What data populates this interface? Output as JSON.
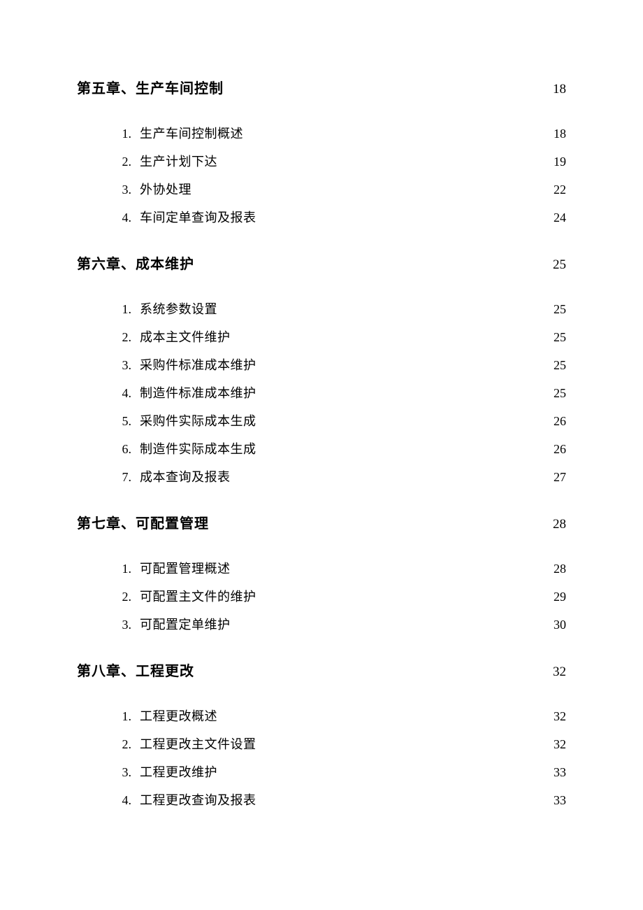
{
  "chapters": [
    {
      "title": "第五章、生产车间控制",
      "page": "18",
      "sections": [
        {
          "num": "1.",
          "title": "生产车间控制概述",
          "page": "18"
        },
        {
          "num": "2.",
          "title": "生产计划下达",
          "page": "19"
        },
        {
          "num": "3.",
          "title": "外协处理",
          "page": "22"
        },
        {
          "num": "4.",
          "title": "车间定单查询及报表",
          "page": "24"
        }
      ]
    },
    {
      "title": "第六章、成本维护",
      "page": "25",
      "sections": [
        {
          "num": "1.",
          "title": "系统参数设置",
          "page": "25"
        },
        {
          "num": "2.",
          "title": "成本主文件维护",
          "page": "25"
        },
        {
          "num": "3.",
          "title": "采购件标准成本维护",
          "page": "25"
        },
        {
          "num": "4.",
          "title": "制造件标准成本维护",
          "page": "25"
        },
        {
          "num": "5.",
          "title": "采购件实际成本生成",
          "page": "26"
        },
        {
          "num": "6.",
          "title": "制造件实际成本生成",
          "page": "26"
        },
        {
          "num": "7.",
          "title": "成本查询及报表",
          "page": "27"
        }
      ]
    },
    {
      "title": "第七章、可配置管理",
      "page": "28",
      "sections": [
        {
          "num": "1.",
          "title": "可配置管理概述",
          "page": "28"
        },
        {
          "num": "2.",
          "title": "可配置主文件的维护",
          "page": "29"
        },
        {
          "num": "3.",
          "title": "可配置定单维护",
          "page": "30"
        }
      ]
    },
    {
      "title": "第八章、工程更改",
      "page": "32",
      "sections": [
        {
          "num": "1.",
          "title": "工程更改概述",
          "page": "32"
        },
        {
          "num": "2.",
          "title": "工程更改主文件设置",
          "page": "32"
        },
        {
          "num": "3.",
          "title": "工程更改维护",
          "page": "33"
        },
        {
          "num": "4.",
          "title": "工程更改查询及报表",
          "page": "33"
        }
      ]
    }
  ]
}
